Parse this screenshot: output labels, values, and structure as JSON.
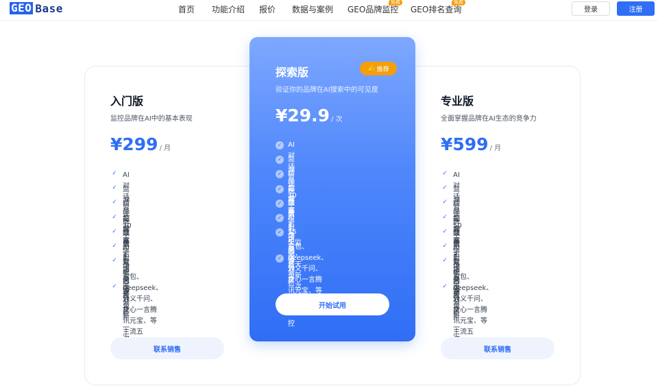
{
  "header": {
    "logo_geo": "GEO",
    "logo_base": "Base",
    "nav": [
      {
        "label": "首页"
      },
      {
        "label": "功能介绍"
      },
      {
        "label": "报价"
      },
      {
        "label": "数据与案例"
      },
      {
        "label": "GEO品牌监控",
        "badge": "免费"
      },
      {
        "label": "GEO排名查询",
        "badge": "免费"
      }
    ],
    "login_label": "登录",
    "register_label": "注册"
  },
  "plans": {
    "basic": {
      "title": "入门版",
      "desc": "监控品牌在AI中的基本表现",
      "price": "¥299",
      "unit": "/ 月",
      "features": [
        "AI对话监控洞察",
        "监测品牌数量1个",
        "精选30个AI对话问答",
        "品牌竞争对手分析",
        "品牌市场占比分析",
        "AI引用来源分析",
        "数据三天更新一次",
        "豆包、deepseek、通义千问、\n文心一言腾讯元宝、等主流五\n大AI平台监控"
      ],
      "button": "联系销售"
    },
    "explore": {
      "title": "探索版",
      "badge": "推荐",
      "desc": "验证你的品牌在AI搜索中的可见度",
      "price": "¥29.9",
      "unit": "/ 次",
      "features": [
        "AI对话监控洞察",
        "监测品牌数量1个",
        "精选30个AI对话问答",
        "品牌竞争对手分析",
        "品牌市场占比分析",
        "AI引用来源分析",
        "15天监测，三天更新一次",
        "豆包、deepseek、通义千问、\n文心一言腾讯元宝、等主流五\n大AI平台监控"
      ],
      "button": "开始试用"
    },
    "pro": {
      "title": "专业版",
      "desc": "全面掌握品牌在AI生态的竞争力",
      "price": "¥599",
      "unit": "/ 月",
      "features": [
        "AI对话监控洞察",
        "监测品牌数量3个",
        "精选50个AI对话问答",
        "品牌竞争对手分析",
        "品牌市场占比分析",
        "AI引用来源分析",
        "数据三天更新一次",
        "豆包、deepseek、通义千问、\n文心一言腾讯元宝、等主流五\n大AI平台监控"
      ],
      "button": "联系销售"
    }
  },
  "colors": {
    "primary": "#2f6ef5",
    "badge": "#f59e0b"
  }
}
